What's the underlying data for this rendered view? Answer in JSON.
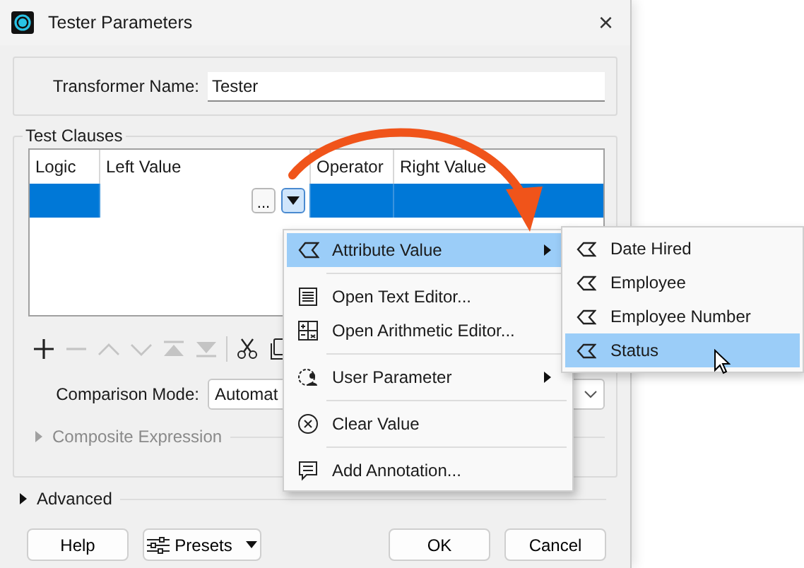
{
  "window": {
    "title": "Tester Parameters",
    "close": "×"
  },
  "transformer_name": {
    "label": "Transformer Name:",
    "value": "Tester"
  },
  "test_clauses": {
    "title": "Test Clauses",
    "table": {
      "columns": [
        "Logic",
        "Left Value",
        "Operator",
        "Right Value"
      ],
      "rows": [
        {
          "selected": true,
          "ellipsis": "..."
        }
      ]
    },
    "toolbar": [
      {
        "kind": "add",
        "disabled": false
      },
      {
        "kind": "remove",
        "disabled": true
      },
      {
        "kind": "up",
        "disabled": true
      },
      {
        "kind": "down",
        "disabled": true
      },
      {
        "kind": "top",
        "disabled": true
      },
      {
        "kind": "bottom",
        "disabled": true
      },
      {
        "kind": "cut",
        "disabled": false
      },
      {
        "kind": "copy"
      }
    ],
    "comparison_mode": {
      "label": "Comparison Mode:",
      "value": "Automat"
    },
    "composite_expression": {
      "label": "Composite Expression",
      "disabled": true,
      "expanded": false
    }
  },
  "advanced": {
    "label": "Advanced",
    "expanded": false
  },
  "buttons": [
    {
      "kind": "help",
      "label": "Help"
    },
    {
      "kind": "presets",
      "label": "Presets"
    },
    {
      "kind": "ok",
      "label": "OK"
    },
    {
      "kind": "cancel",
      "label": "Cancel"
    }
  ],
  "context_menu": {
    "groups": [
      [
        {
          "kind": "attribute",
          "label": "Attribute Value",
          "submenu": true,
          "selected": true
        }
      ],
      [
        {
          "kind": "text-editor",
          "label": "Open Text Editor...",
          "submenu": false,
          "selected": false
        },
        {
          "kind": "arithmetic",
          "label": "Open Arithmetic Editor...",
          "submenu": false,
          "selected": false
        }
      ],
      [
        {
          "kind": "user-parameter",
          "label": "User Parameter",
          "submenu": true,
          "selected": false
        }
      ],
      [
        {
          "kind": "clear",
          "label": "Clear Value",
          "submenu": false,
          "selected": false
        }
      ],
      [
        {
          "kind": "annotation",
          "label": "Add Annotation...",
          "submenu": false,
          "selected": false
        }
      ]
    ]
  },
  "submenu": {
    "items": [
      {
        "label": "Date Hired",
        "selected": false
      },
      {
        "label": "Employee",
        "selected": false
      },
      {
        "label": "Employee Number",
        "selected": false
      },
      {
        "label": "Status",
        "selected": true
      }
    ]
  }
}
